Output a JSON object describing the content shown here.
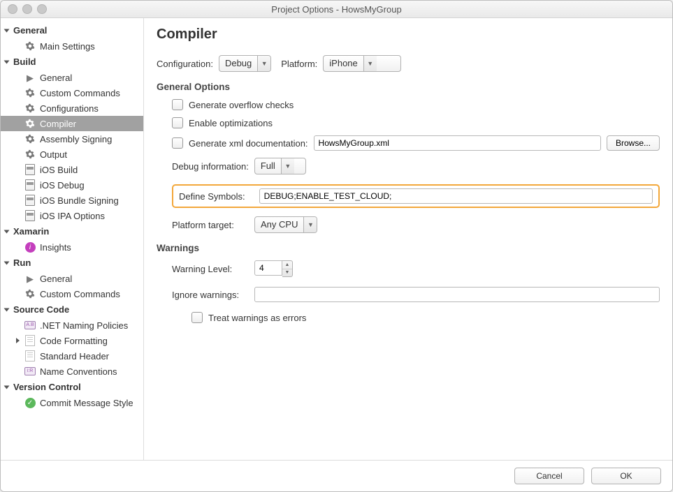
{
  "window": {
    "title": "Project Options - HowsMyGroup"
  },
  "sidebar": {
    "cat_general": "General",
    "general_items": [
      "Main Settings"
    ],
    "cat_build": "Build",
    "build_items": [
      "General",
      "Custom Commands",
      "Configurations",
      "Compiler",
      "Assembly Signing",
      "Output",
      "iOS Build",
      "iOS Debug",
      "iOS Bundle Signing",
      "iOS IPA Options"
    ],
    "build_selected_index": 3,
    "cat_xamarin": "Xamarin",
    "xamarin_items": [
      "Insights"
    ],
    "cat_run": "Run",
    "run_items": [
      "General",
      "Custom Commands"
    ],
    "cat_source": "Source Code",
    "source_items": [
      ".NET Naming Policies",
      "Code Formatting",
      "Standard Header",
      "Name Conventions"
    ],
    "cat_vc": "Version Control",
    "vc_items": [
      "Commit Message Style"
    ]
  },
  "page": {
    "title": "Compiler",
    "config_label": "Configuration:",
    "config_value": "Debug",
    "platform_label": "Platform:",
    "platform_value": "iPhone",
    "section_general": "General Options",
    "opt_overflow": "Generate overflow checks",
    "opt_optim": "Enable optimizations",
    "opt_xmldoc": "Generate xml documentation:",
    "xmldoc_value": "HowsMyGroup.xml",
    "browse": "Browse...",
    "debug_info_label": "Debug information:",
    "debug_info_value": "Full",
    "define_label": "Define Symbols:",
    "define_value": "DEBUG;ENABLE_TEST_CLOUD;",
    "platform_target_label": "Platform target:",
    "platform_target_value": "Any CPU",
    "section_warnings": "Warnings",
    "warn_level_label": "Warning Level:",
    "warn_level_value": "4",
    "ignore_label": "Ignore warnings:",
    "ignore_value": "",
    "treat_warn": "Treat warnings as errors"
  },
  "footer": {
    "cancel": "Cancel",
    "ok": "OK"
  }
}
